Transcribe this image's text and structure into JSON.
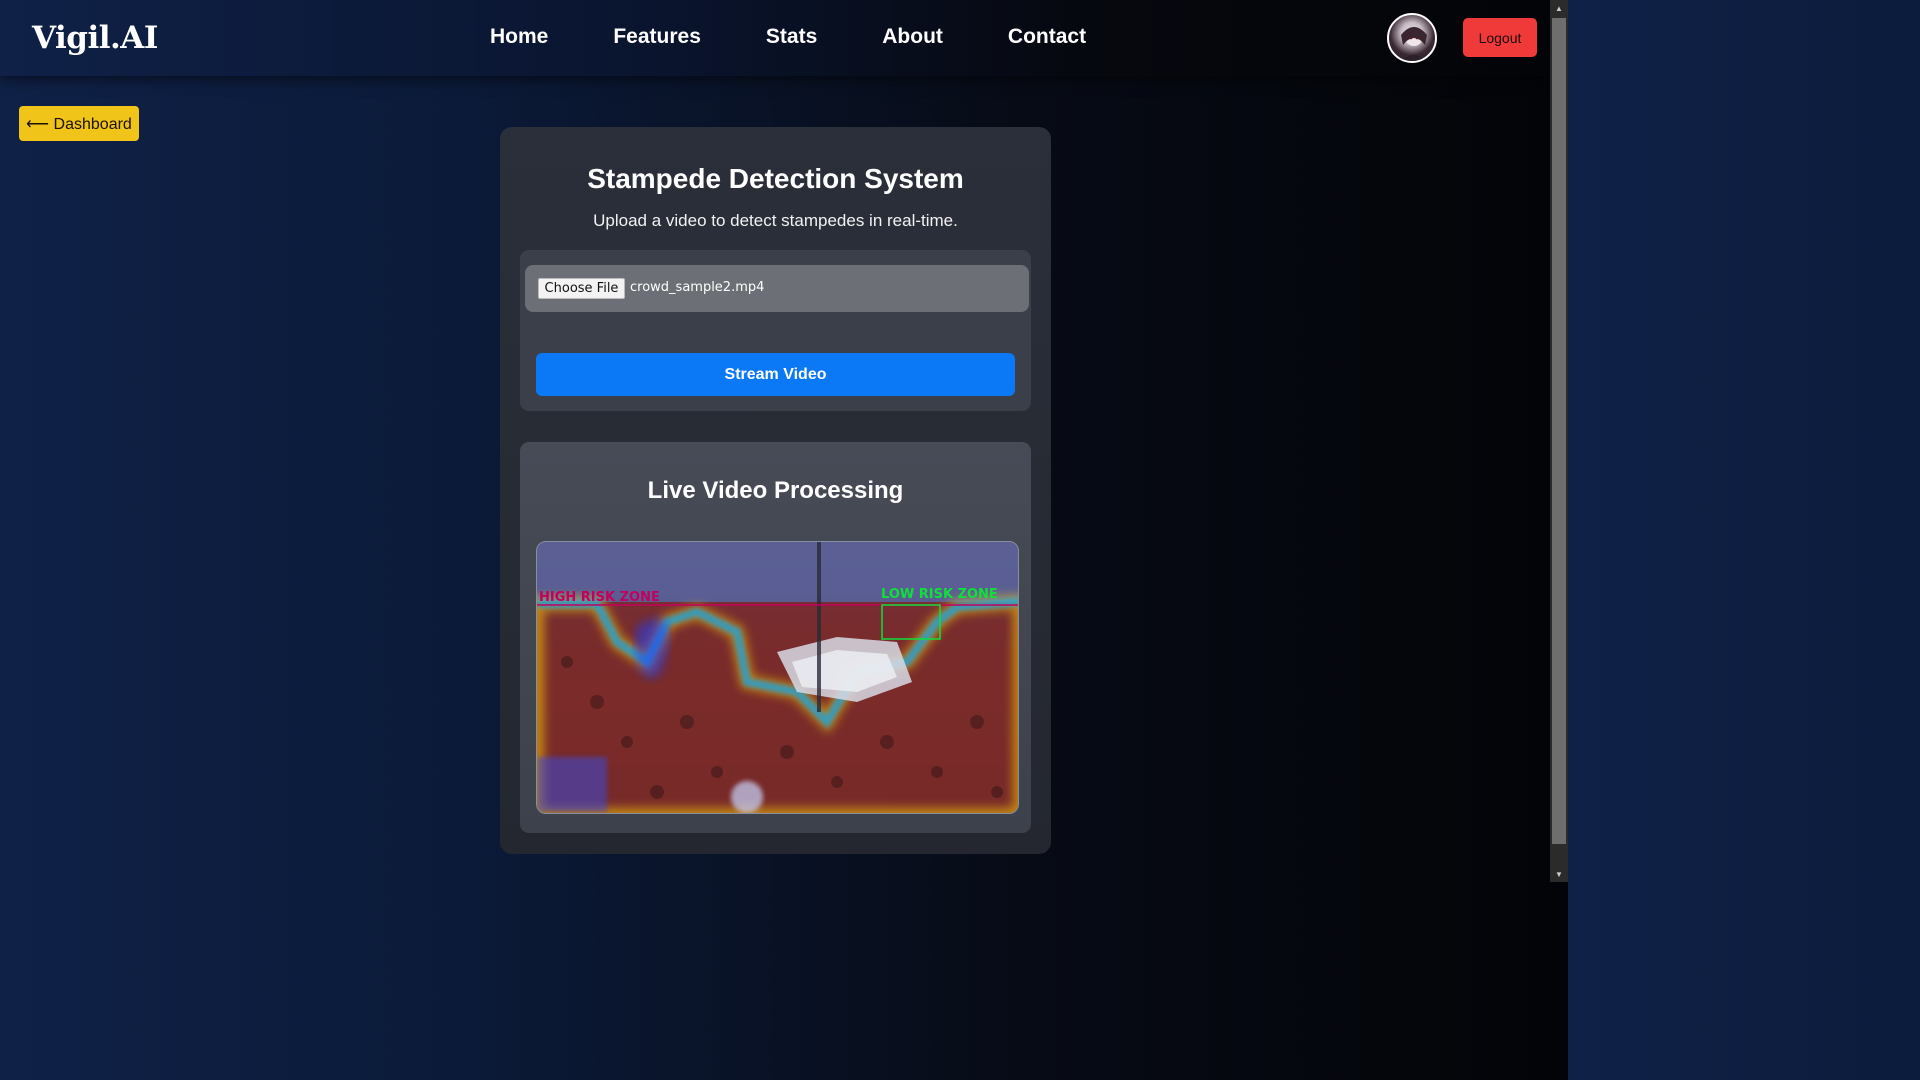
{
  "nav": {
    "logo": "Vigil.AI",
    "links": [
      "Home",
      "Features",
      "Stats",
      "About",
      "Contact"
    ],
    "logout_label": "Logout"
  },
  "dashboard_button": "⟵ Dashboard",
  "card": {
    "title": "Stampede Detection System",
    "subtitle": "Upload a video to detect stampedes in real-time.",
    "file_input": {
      "button_label": "Choose File",
      "file_name": "crowd_sample2.mp4"
    },
    "stream_button": "Stream Video",
    "live": {
      "title": "Live Video Processing",
      "high_zone_label": "HIGH RISK ZONE",
      "low_zone_label": "LOW RISK ZONE"
    }
  },
  "colors": {
    "logout": "#f03a3a",
    "dashboard": "#f0c419",
    "stream": "#0b78f5",
    "high_risk": "#c4005e",
    "low_risk": "#0fe03a"
  }
}
